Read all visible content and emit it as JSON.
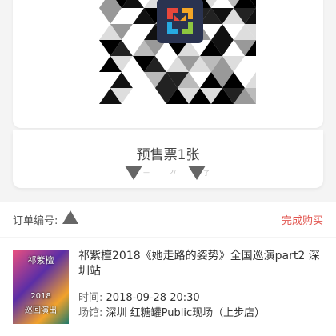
{
  "ticket": {
    "title": "预售票1张",
    "faint_left": "—",
    "faint_mid": "2/",
    "faint_right": "了"
  },
  "order": {
    "label": "订单编号:",
    "action": "完成购买",
    "action_color": "#e2554f"
  },
  "event": {
    "title": "祁紫檀2018《她走路的姿势》全国巡演part2 深圳站",
    "time_label": "时间:",
    "time_value": "2018-09-28 20:30",
    "venue_label": "场馆:",
    "venue_value": "深圳 红糖罐Public现场（上步店）",
    "poster_line1": "祁紫檀",
    "poster_line2": "2018",
    "poster_line3": "巡回演出"
  }
}
